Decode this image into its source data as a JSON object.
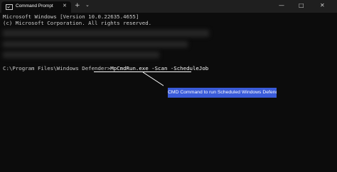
{
  "window": {
    "tab_title": "Command Prompt",
    "tab_close_glyph": "✕",
    "new_tab_glyph": "+",
    "dropdown_glyph": "⌄",
    "min_glyph": "—",
    "max_glyph": "□",
    "close_glyph": "✕"
  },
  "console": {
    "line1": "Microsoft Windows [Version 10.0.22635.4655]",
    "line2": "(c) Microsoft Corporation. All rights reserved.",
    "prompt_path": "C:\\Program Files\\Windows Defender>",
    "command": "MpCmdRun.exe -Scan -ScheduleJob"
  },
  "annotation": {
    "callout_text": "CMD Command to run Scheduled Windows Defender Scan",
    "callout_color": "#3a5bd9"
  },
  "icons": {
    "tab_icon": "terminal-icon"
  }
}
